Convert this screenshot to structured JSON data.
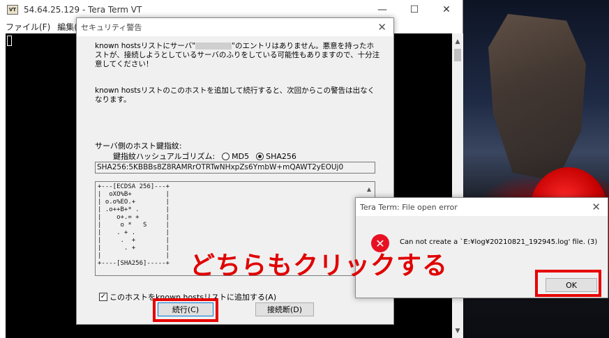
{
  "window": {
    "title": "54.64.25.129 - Tera Term VT",
    "app_icon_text": "VT",
    "menu": [
      "ファイル(F)",
      "編集(E)"
    ]
  },
  "security_dialog": {
    "title": "セキュリティ警告",
    "message1_pre": "known hostsリストにサーバ\"",
    "message1_post": "\"のエントリはありません。悪意を持ったホストが、接続しようとしているサーバのふりをしている可能性もありますので、十分注意してください！",
    "message2": "known hostsリストのこのホストを追加して続行すると、次回からこの警告は出なくなります。",
    "fingerprint_label": "サーバ側のホスト鍵指紋:",
    "hash_algo_label": "鍵指紋ハッシュアルゴリズム:",
    "options": [
      "MD5",
      "SHA256"
    ],
    "selected_option": "SHA256",
    "fingerprint": "SHA256:5KBBBs8Z8RAMRrOTRTwNHxpZs6YmbW+mQAWT2yEOUj0",
    "randomart": "+---[ECDSA 256]---+\n|  oXO%B+         |\n| o.o%EO.+        |\n| .o++B+* .       |\n|    o+.= +       |\n|     o *   S     |\n|    . + .        |\n|     .  +        |\n|      . +        |\n|                 |\n+----[SHA256]-----+",
    "add_checkbox_label": "このホストをknown hostsリストに追加する(A)",
    "add_checked": true,
    "continue_label": "続行(C)",
    "disconnect_label": "接続断(D)"
  },
  "error_dialog": {
    "title": "Tera Term: File open error",
    "message": "Can not create a `E:¥log¥20210821_192945.log' file. (3)",
    "ok_label": "OK"
  },
  "callout_text": "どちらもクリックする",
  "colors": {
    "highlight": "#e60000",
    "error_icon": "#e81123"
  }
}
